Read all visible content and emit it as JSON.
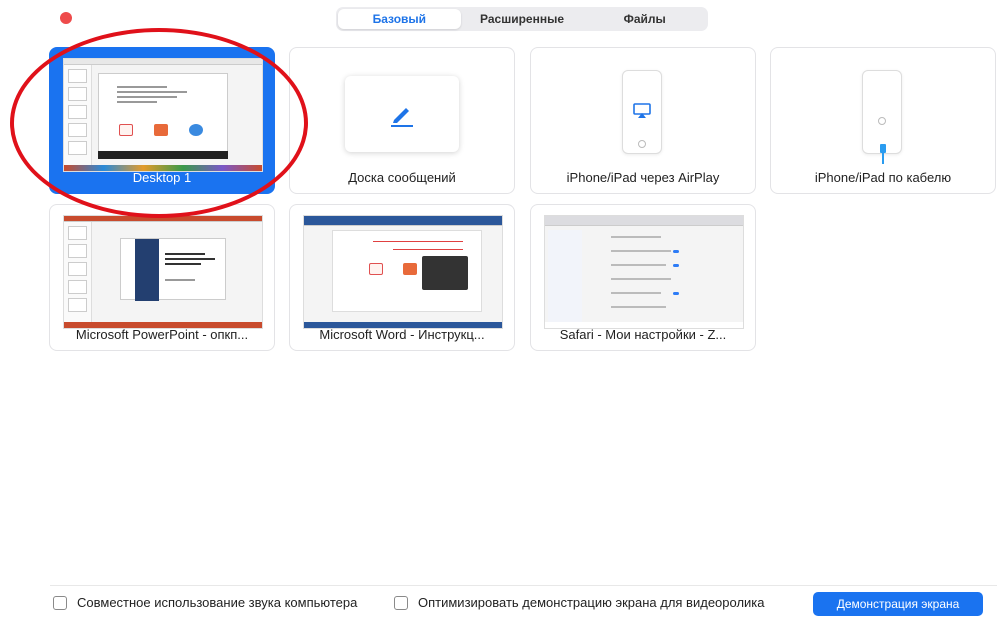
{
  "tabs": [
    {
      "label": "Базовый",
      "active": true
    },
    {
      "label": "Расширенные",
      "active": false
    },
    {
      "label": "Файлы",
      "active": false
    }
  ],
  "sources": [
    {
      "label": "Desktop 1",
      "selected": true,
      "icon": "desktop-thumbnail"
    },
    {
      "label": "Доска сообщений",
      "selected": false,
      "icon": "pencil-icon"
    },
    {
      "label": "iPhone/iPad через AirPlay",
      "selected": false,
      "icon": "airplay-icon"
    },
    {
      "label": "iPhone/iPad по кабелю",
      "selected": false,
      "icon": "cable-icon"
    },
    {
      "label": "Microsoft PowerPoint - опкп...",
      "selected": false,
      "icon": "powerpoint-thumbnail"
    },
    {
      "label": "Microsoft Word - Инструкц...",
      "selected": false,
      "icon": "word-thumbnail"
    },
    {
      "label": "Safari - Мои настройки - Z...",
      "selected": false,
      "icon": "safari-thumbnail"
    }
  ],
  "footer": {
    "share_audio_label": "Совместное использование звука компьютера",
    "share_audio_checked": false,
    "optimize_video_label": "Оптимизировать демонстрацию экрана для видеоролика",
    "optimize_video_checked": false,
    "share_button_label": "Демонстрация экрана"
  },
  "colors": {
    "accent": "#1a73f0",
    "close": "#ee4b4b",
    "annotation": "#e0111a"
  }
}
